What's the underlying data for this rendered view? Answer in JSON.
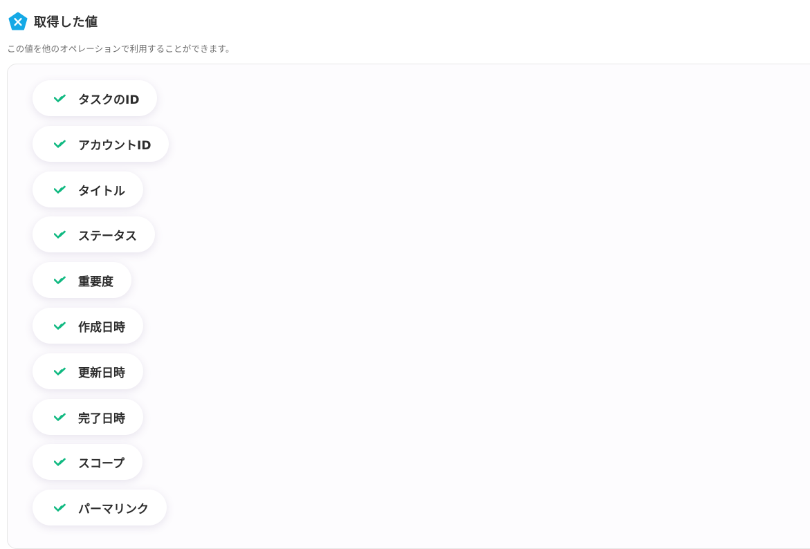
{
  "header": {
    "title": "取得した値",
    "logo_icon": "x-pentagon-logo-icon",
    "accent_color": "#15a9e6"
  },
  "subtitle": "この値を他のオペレーションで利用することができます。",
  "values": {
    "check_color": "#10b981",
    "items": [
      {
        "label": "タスクのID"
      },
      {
        "label": "アカウントID"
      },
      {
        "label": "タイトル"
      },
      {
        "label": "ステータス"
      },
      {
        "label": "重要度"
      },
      {
        "label": "作成日時"
      },
      {
        "label": "更新日時"
      },
      {
        "label": "完了日時"
      },
      {
        "label": "スコープ"
      },
      {
        "label": "パーマリンク"
      }
    ]
  }
}
